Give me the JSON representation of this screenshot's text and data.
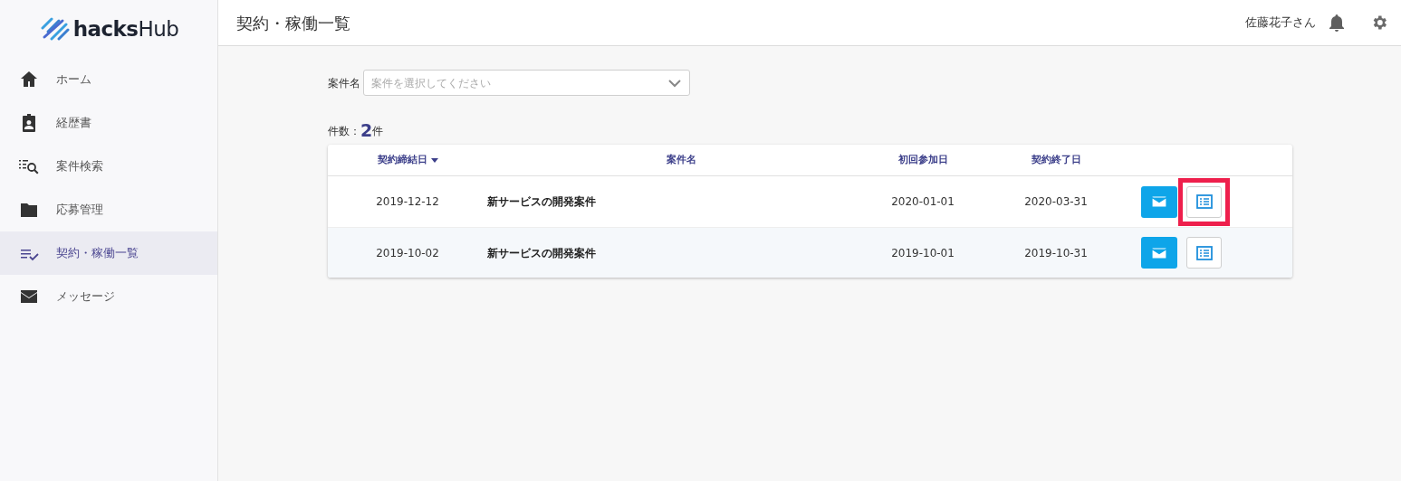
{
  "logo": {
    "text_bold": "hacks",
    "text_light": "Hub"
  },
  "sidebar": {
    "items": [
      {
        "label": "ホーム",
        "kind": "home",
        "selected": false
      },
      {
        "label": "経歴書",
        "kind": "badge",
        "selected": false
      },
      {
        "label": "案件検索",
        "kind": "search",
        "selected": false
      },
      {
        "label": "応募管理",
        "kind": "folder",
        "selected": false
      },
      {
        "label": "契約・稼働一覧",
        "kind": "checklist",
        "selected": true
      },
      {
        "label": "メッセージ",
        "kind": "mail",
        "selected": false
      }
    ]
  },
  "header": {
    "title": "契約・稼働一覧",
    "user": "佐藤花子さん"
  },
  "filter": {
    "label": "案件名",
    "placeholder": "案件を選択してください"
  },
  "count": {
    "label": "件数：",
    "value": "2",
    "unit": "件"
  },
  "table": {
    "columns": [
      {
        "label": "契約締結日",
        "sorted": true
      },
      {
        "label": "案件名",
        "sorted": false
      },
      {
        "label": "初回参加日",
        "sorted": false
      },
      {
        "label": "契約終了日",
        "sorted": false
      }
    ],
    "rows": [
      {
        "cells": [
          "2019-12-12",
          "新サービスの開発案件",
          "2020-01-01",
          "2020-03-31"
        ],
        "highlighted": true
      },
      {
        "cells": [
          "2019-10-02",
          "新サービスの開発案件",
          "2019-10-01",
          "2019-10-31"
        ],
        "highlighted": false
      }
    ]
  }
}
